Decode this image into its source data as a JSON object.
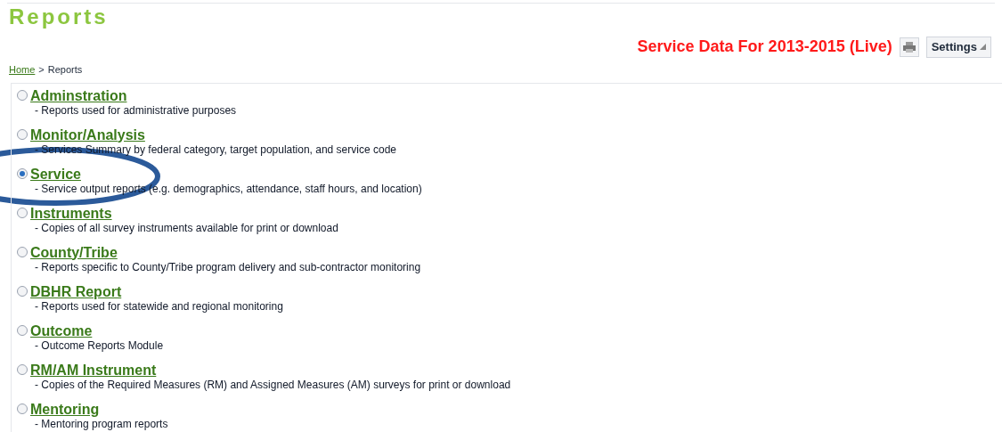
{
  "page_title": "Reports",
  "data_banner": "Service Data For 2013-2015 (Live)",
  "settings_button": "Settings",
  "breadcrumb": {
    "link": "Home",
    "separator": ">",
    "current": "Reports"
  },
  "report_categories": [
    {
      "label": "Adminstration",
      "description": "- Reports used for administrative purposes",
      "selected": false
    },
    {
      "label": "Monitor/Analysis",
      "description": "- Services Summary by federal category, target population, and service code",
      "selected": false
    },
    {
      "label": "Service",
      "description": "- Service output reports (e.g. demographics, attendance, staff hours, and location)",
      "selected": true
    },
    {
      "label": "Instruments",
      "description": "- Copies of all survey instruments available for print or download",
      "selected": false
    },
    {
      "label": "County/Tribe",
      "description": "- Reports specific to County/Tribe program delivery and sub-contractor monitoring",
      "selected": false
    },
    {
      "label": "DBHR Report",
      "description": "- Reports used for statewide and regional monitoring",
      "selected": false
    },
    {
      "label": "Outcome",
      "description": "- Outcome Reports Module",
      "selected": false
    },
    {
      "label": "RM/AM Instrument",
      "description": "- Copies of the Required Measures (RM) and Assigned Measures (AM) surveys for print or download",
      "selected": false
    },
    {
      "label": "Mentoring",
      "description": "- Mentoring program reports",
      "selected": false
    }
  ]
}
